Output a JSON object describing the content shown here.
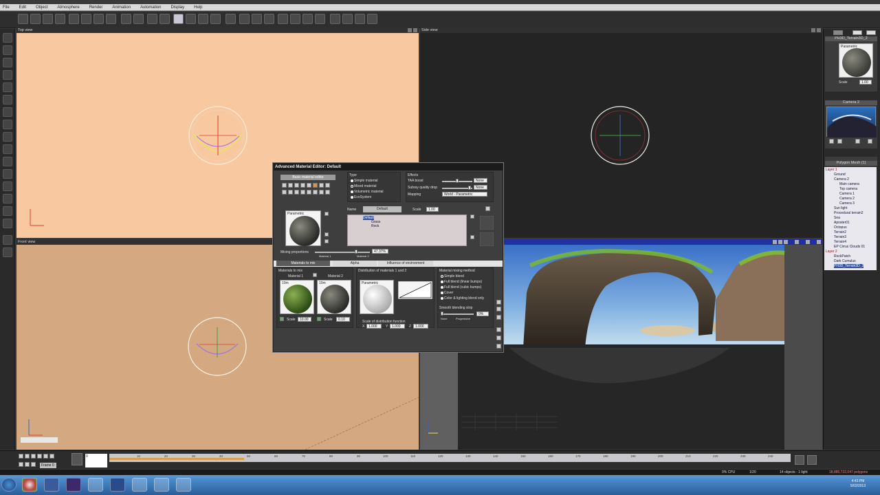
{
  "menu": [
    "File",
    "Edit",
    "Object",
    "Atmosphere",
    "Render",
    "Animation",
    "Automation",
    "Display",
    "Help"
  ],
  "viewports": {
    "top": "Top view",
    "side": "Side view",
    "front": "Front view"
  },
  "right_panel": {
    "object_name": "PH3D_Terrain3D_2",
    "preview_label": "Parametric",
    "scale_label": "Scale",
    "scale_value": "1.00",
    "camera_title": "Camera 2",
    "tree_title": "Polygon Mesh (1)",
    "tree": [
      {
        "label": "Layer 1",
        "style": "red"
      },
      {
        "label": "Ground",
        "style": ""
      },
      {
        "label": "Camera 2",
        "style": ""
      },
      {
        "label": "Main camera",
        "style": ""
      },
      {
        "label": "Top camera",
        "style": ""
      },
      {
        "label": "Camera 1",
        "style": ""
      },
      {
        "label": "Camera 2",
        "style": ""
      },
      {
        "label": "Camera 3",
        "style": ""
      },
      {
        "label": "Sun light",
        "style": ""
      },
      {
        "label": "Procedural terrain2",
        "style": ""
      },
      {
        "label": "Sea",
        "style": ""
      },
      {
        "label": "Aposter01",
        "style": ""
      },
      {
        "label": "Octopus",
        "style": ""
      },
      {
        "label": "Terrain2",
        "style": ""
      },
      {
        "label": "Terrain3",
        "style": ""
      },
      {
        "label": "Terrain4",
        "style": ""
      },
      {
        "label": "EP Cirrus Clouds 01",
        "style": ""
      },
      {
        "label": "Layer 2",
        "style": "red"
      },
      {
        "label": "RockPatch",
        "style": ""
      },
      {
        "label": "Dark Cumulus",
        "style": ""
      },
      {
        "label": "PH3D_Terrain3D_2",
        "style": "sel"
      }
    ]
  },
  "dialog": {
    "title": "Advanced Material Editor: Default",
    "basic_editor_btn": "Basic material editor",
    "type_label": "Type",
    "type_options": [
      "Simple material",
      "Mixed material",
      "Volumetric material",
      "EcoSystem"
    ],
    "effects_label": "Effects",
    "taa_boost": "TAA boost",
    "taa_value": "None",
    "subray_quality": "Subray quality drop",
    "subray_value": "None",
    "mapping_label": "Mapping",
    "mapping_value": "World - Parametric",
    "preview_label": "Parametric",
    "name_label": "Name",
    "name_value": "Default",
    "scale_label": "Scale",
    "scale_value": "1.00",
    "tree": [
      "Default",
      "Grass",
      "Rock"
    ],
    "mixing_label": "Mixing proportions",
    "mixing_value": "47.37%",
    "material1_short": "Material 1",
    "material2_short": "Material 2",
    "tabs": [
      "Materials to mix",
      "Alpha",
      "Influence of environment"
    ],
    "materials_to_mix": "Materials to mix",
    "material1": "Material 1",
    "material2": "Material 2",
    "mat1_scale_label": "Scale",
    "mat1_scale": "10.00",
    "mat2_scale_label": "Scale",
    "mat2_scale": "0.10",
    "mat_thumb_label": "10m",
    "distribution_label": "Distribution of materials 1 and 2",
    "dist_preview_label": "Parametric",
    "scale_dist_label": "Scale of distribution function",
    "x_label": "X",
    "x_value": "1.000",
    "y_label": "Y",
    "y_value": "1.000",
    "z_label": "Z",
    "z_value": "1.000",
    "mixing_method": "Material mixing method",
    "mixing_options": [
      "Simple blend",
      "Full blend (linear bumps)",
      "Full blend (cubic bumps)",
      "Cover",
      "Color & lighting blend only"
    ],
    "smooth_label": "Smooth blending strip",
    "smooth_value": "0%",
    "smooth_none": "None",
    "smooth_progressive": "Progressive"
  },
  "timeline": {
    "frame_label": "Frame 0",
    "start_frame": "0",
    "ticks": [
      "10",
      "20",
      "30",
      "40",
      "50",
      "60",
      "70",
      "80",
      "90",
      "100",
      "110",
      "120",
      "130",
      "140",
      "150",
      "160",
      "170",
      "180",
      "190",
      "200",
      "210",
      "220",
      "230",
      "240"
    ]
  },
  "status": {
    "cpu": "0% CPU",
    "zoom": "1/20",
    "objects": "14 objects - 1 light",
    "polygons": "18,885,722,047 polygons"
  },
  "taskbar": {
    "time": "4:43 PM",
    "date": "5/02/2013",
    "apps": [
      "start",
      "chrome",
      "vue",
      "ae",
      "tool",
      "vue2",
      "folder",
      "note",
      "tool3"
    ]
  }
}
